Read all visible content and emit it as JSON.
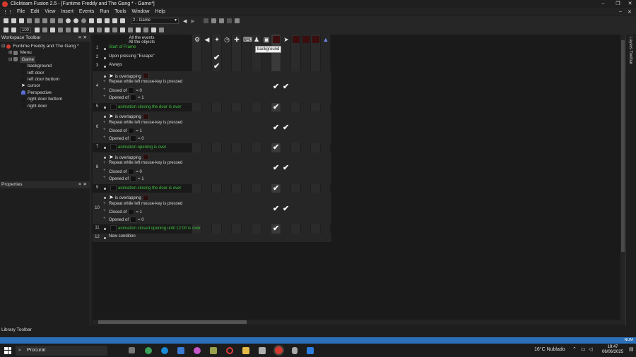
{
  "window": {
    "title": "Clickteam Fusion 2.5 - [Funtime Freddy and The Gang * - Game*]",
    "minimize": "–",
    "restore": "❐",
    "close": "✕"
  },
  "menu": [
    "File",
    "Edit",
    "View",
    "Insert",
    "Events",
    "Run",
    "Tools",
    "Window",
    "Help"
  ],
  "toolbar": {
    "frame_select": "2 - Game",
    "zoom": "100"
  },
  "workspace": {
    "title": "Workspace Toolbar",
    "pin": "⨯",
    "close": "✕",
    "tree": [
      {
        "label": "Funtime Freddy and The Gang *",
        "level": 0,
        "icon": "app-icon"
      },
      {
        "label": "Menu",
        "level": 1,
        "icon": "frame-icon"
      },
      {
        "label": "Game",
        "level": 1,
        "icon": "frame-icon",
        "selected": true
      },
      {
        "label": "background",
        "level": 2,
        "icon": "active-object-icon"
      },
      {
        "label": "left door",
        "level": 2,
        "icon": "active-object-icon"
      },
      {
        "label": "left door buttom",
        "level": 2,
        "icon": "active-object-icon"
      },
      {
        "label": "cursor",
        "level": 2,
        "icon": "cursor-icon"
      },
      {
        "label": "Perspective",
        "level": 2,
        "icon": "perspective-icon"
      },
      {
        "label": "right door buttom",
        "level": 2,
        "icon": "active-object-icon"
      },
      {
        "label": "right door",
        "level": 2,
        "icon": "active-object-icon"
      }
    ]
  },
  "properties": {
    "title": "Properties"
  },
  "library": {
    "title": "Library Toolbar"
  },
  "layers": {
    "title": "Layers Toolbar"
  },
  "events_header": {
    "line1": "All the events",
    "line2": "All the objects",
    "tooltip": "background"
  },
  "events": [
    {
      "num": "1",
      "conds": [
        {
          "text": "Start of Frame",
          "green": true
        }
      ],
      "checks": []
    },
    {
      "num": "2",
      "conds": [
        {
          "text": "Upon pressing \"Escape\""
        }
      ],
      "checks": [
        2
      ]
    },
    {
      "num": "3",
      "conds": [
        {
          "text": "Always"
        }
      ],
      "checks": [
        2
      ]
    },
    {
      "num": "4",
      "conds": [
        {
          "text": "is overlapping",
          "obj": true
        },
        {
          "text": "Repeat while left mouse-key is pressed",
          "plus": true
        },
        {
          "text": "Closed of",
          "suffix": "= 0",
          "plus": true,
          "box": true
        },
        {
          "text": "Opened of",
          "suffix": "= 1",
          "plus": true,
          "box": true
        }
      ],
      "checks": [
        8,
        9
      ]
    },
    {
      "num": "5",
      "conds": [
        {
          "text": "animation closing the door is over",
          "green": true,
          "box": true
        }
      ],
      "checks": [
        8
      ]
    },
    {
      "num": "6",
      "conds": [
        {
          "text": "is overlapping",
          "obj": true
        },
        {
          "text": "Repeat while left mouse-key is pressed",
          "plus": true
        },
        {
          "text": "Closed of",
          "suffix": "= 1",
          "plus": true,
          "box": true
        },
        {
          "text": "Opened of",
          "suffix": "= 0",
          "plus": true,
          "box": true
        }
      ],
      "checks": [
        8,
        9
      ]
    },
    {
      "num": "7",
      "conds": [
        {
          "text": "animation opening is over",
          "green": true,
          "box": true
        }
      ],
      "checks": [
        8
      ]
    },
    {
      "num": "8",
      "conds": [
        {
          "text": "is overlapping",
          "obj": true
        },
        {
          "text": "Repeat while left mouse-key is pressed",
          "plus": true
        },
        {
          "text": "Closed of",
          "suffix": "= 0",
          "plus": true,
          "box": true
        },
        {
          "text": "Opened of",
          "suffix": "= 1",
          "plus": true,
          "box": true
        }
      ],
      "checks": [
        8,
        9
      ]
    },
    {
      "num": "9",
      "conds": [
        {
          "text": "animation closing the door is over",
          "green": true,
          "box": true
        }
      ],
      "checks": [
        8
      ]
    },
    {
      "num": "10",
      "conds": [
        {
          "text": "is overlapping",
          "obj": true
        },
        {
          "text": "Repeat while left mouse-key is pressed",
          "plus": true
        },
        {
          "text": "Closed of",
          "suffix": "= 1",
          "plus": true,
          "box": true
        },
        {
          "text": "Opened of",
          "suffix": "= 0",
          "plus": true,
          "box": true
        }
      ],
      "checks": [
        8,
        9
      ]
    },
    {
      "num": "11",
      "conds": [
        {
          "text": "animation closed opening until 12:00 is over",
          "green": true,
          "box": true
        }
      ],
      "checks": [
        8
      ]
    },
    {
      "num": "12",
      "conds": [
        {
          "text": "New condition"
        }
      ],
      "checks": []
    }
  ],
  "taskbar": {
    "search": "Procurar",
    "weather": "16°C Nublado",
    "time": "19:47",
    "date": "06/06/2025",
    "status_right": "NUM"
  },
  "colors": {
    "accent": "#2a6fb8",
    "green_text": "#3fbf3f",
    "app_red": "#d63a2f"
  }
}
